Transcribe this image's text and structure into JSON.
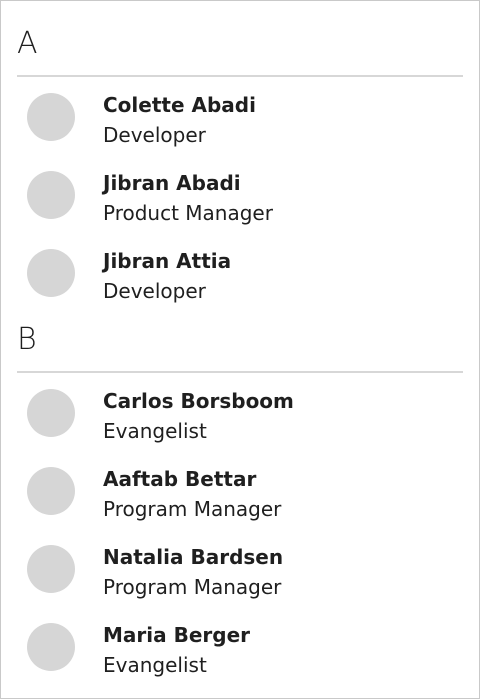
{
  "groups": [
    {
      "letter": "A",
      "contacts": [
        {
          "name": "Colette Abadi",
          "role": "Developer"
        },
        {
          "name": "Jibran Abadi",
          "role": "Product Manager"
        },
        {
          "name": "Jibran Attia",
          "role": "Developer"
        }
      ]
    },
    {
      "letter": "B",
      "contacts": [
        {
          "name": "Carlos Borsboom",
          "role": "Evangelist"
        },
        {
          "name": "Aaftab Bettar",
          "role": "Program Manager"
        },
        {
          "name": "Natalia Bardsen",
          "role": "Program Manager"
        },
        {
          "name": "Maria Berger",
          "role": "Evangelist"
        }
      ]
    }
  ]
}
